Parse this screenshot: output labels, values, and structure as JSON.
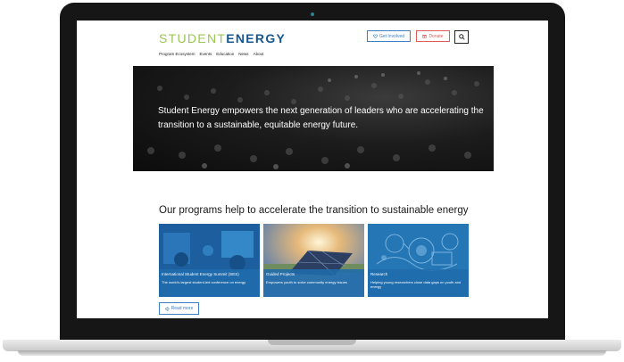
{
  "header": {
    "logo_part1": "STUDENT",
    "logo_part2": "ENERGY",
    "get_involved_label": "Get Involved",
    "donate_label": "Donate"
  },
  "nav": {
    "items": [
      "Program Ecosystem",
      "Events",
      "Education",
      "News",
      "About"
    ]
  },
  "hero": {
    "text": "Student Energy empowers the next generation of leaders who are accelerating the transition to a sustainable, equitable energy future."
  },
  "programs": {
    "heading": "Our programs help to accelerate the transition to sustainable energy",
    "cards": [
      {
        "title": "International Student Energy Summit (SES)",
        "desc": "The world's largest student-led conference on energy"
      },
      {
        "title": "Guided Projects",
        "desc": "Empowers youth to solve community energy issues"
      },
      {
        "title": "Research",
        "desc": "Helping young researchers close data gaps on youth and energy"
      }
    ],
    "read_more_label": "Read more"
  },
  "colors": {
    "logo_green": "#9cc553",
    "logo_blue": "#16588f",
    "accent_blue": "#3d7fc2",
    "donate_red": "#e05a5a",
    "card_overlay": "#1f6cac"
  }
}
